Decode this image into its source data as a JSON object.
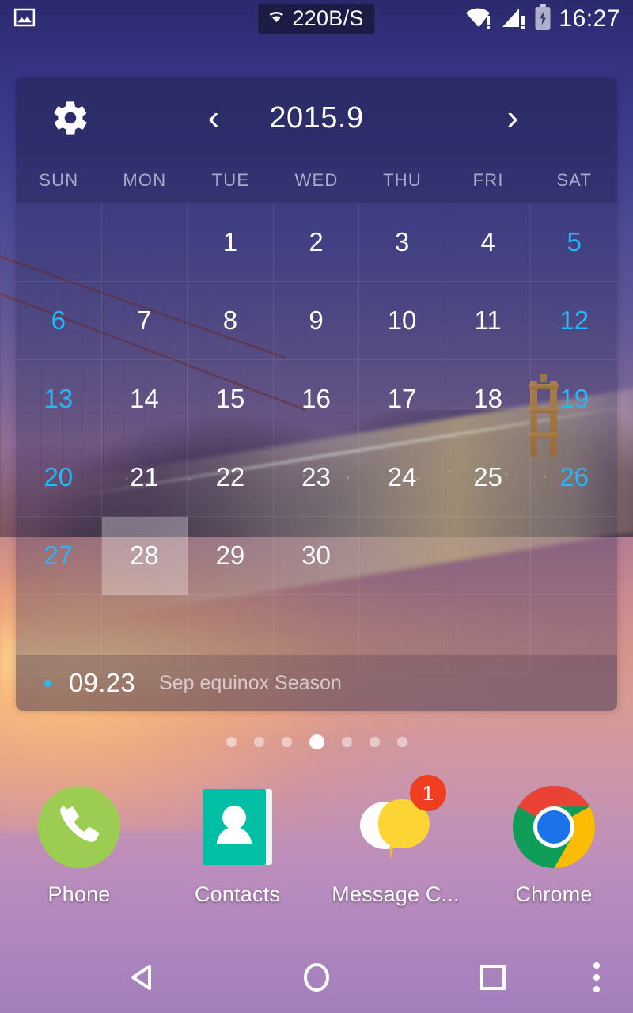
{
  "statusbar": {
    "notification_icon": "photo-icon",
    "network_speed": "220B/S",
    "network_speed_icon": "wifi-small-icon",
    "wifi_icon": "wifi-warning-icon",
    "signal_icon": "cellular-warning-icon",
    "battery_icon": "battery-charging-icon",
    "clock": "16:27"
  },
  "calendar": {
    "settings_icon": "gear-icon",
    "prev_icon": "chevron-left-icon",
    "next_icon": "chevron-right-icon",
    "prev_label": "‹",
    "next_label": "›",
    "title": "2015.9",
    "weekdays": [
      "SUN",
      "MON",
      "TUE",
      "WED",
      "THU",
      "FRI",
      "SAT"
    ],
    "leading_blanks": 2,
    "days": [
      1,
      2,
      3,
      4,
      5,
      6,
      7,
      8,
      9,
      10,
      11,
      12,
      13,
      14,
      15,
      16,
      17,
      18,
      19,
      20,
      21,
      22,
      23,
      24,
      25,
      26,
      27,
      28,
      29,
      30
    ],
    "today": 28,
    "weekend_color": "#29b6f6",
    "weekday_color": "#ffffff",
    "today_highlight": "rgba(255,255,255,0.30)",
    "event": {
      "dot_color": "#2fb9ef",
      "date": "09.23",
      "label": "Sep equinox Season"
    }
  },
  "pages": {
    "count": 7,
    "active_index": 3
  },
  "apps": [
    {
      "label": "Phone",
      "icon": "phone-icon",
      "color": "#9ccc52",
      "badge": null
    },
    {
      "label": "Contacts",
      "icon": "contacts-icon",
      "color": "#00bfa5",
      "badge": null
    },
    {
      "label": "Message C...",
      "icon": "message-icon",
      "color": "#fcd535",
      "badge": "1"
    },
    {
      "label": "Chrome",
      "icon": "chrome-icon",
      "color": "#4285f4",
      "badge": null
    }
  ],
  "navbar": {
    "back_icon": "back-triangle-icon",
    "home_icon": "home-circle-icon",
    "recent_icon": "recents-square-icon",
    "more_icon": "overflow-menu-icon"
  }
}
